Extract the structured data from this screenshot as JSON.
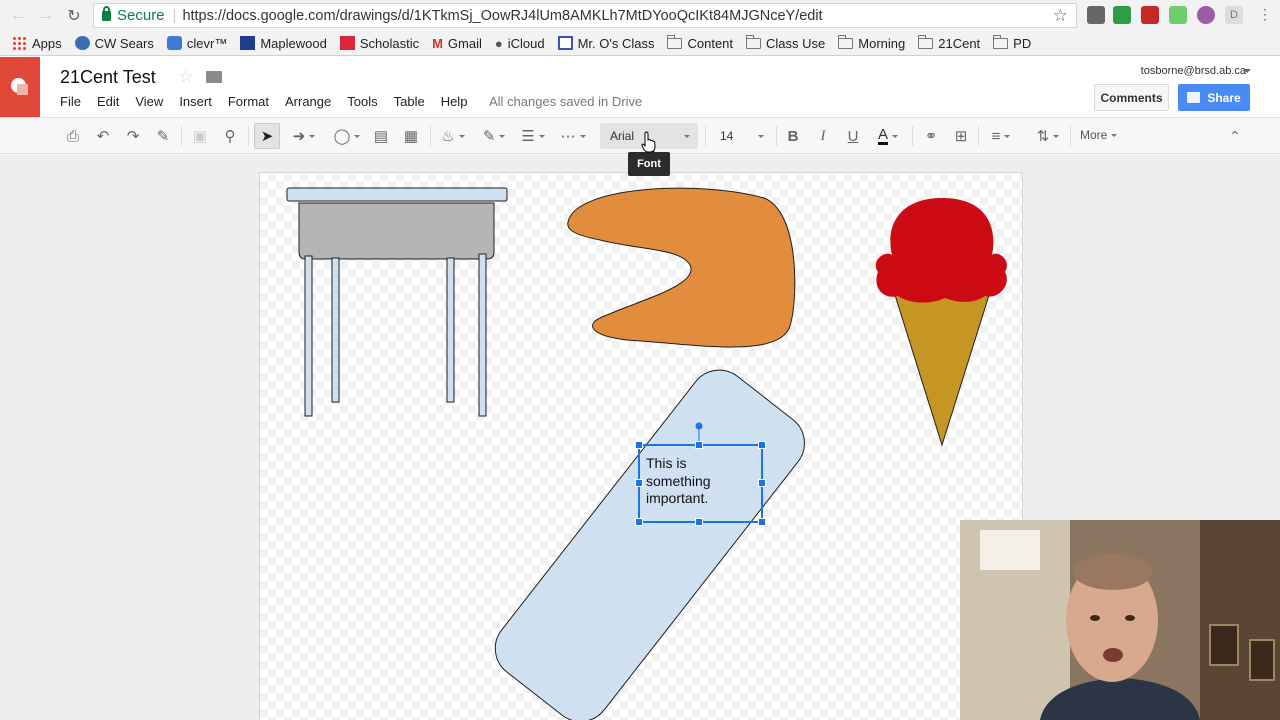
{
  "browser": {
    "secure_label": "Secure",
    "url": "https://docs.google.com/drawings/d/1KTkmSj_OowRJ4lUm8AMKLh7MtDYooQcIKt84MJGNceY/edit",
    "bookmarks": [
      {
        "label": "Apps",
        "icon": "apps-grid-icon"
      },
      {
        "label": "CW Sears",
        "icon": "cw-sears-icon"
      },
      {
        "label": "clevr™",
        "icon": "clever-icon"
      },
      {
        "label": "Maplewood",
        "icon": "maplewood-icon"
      },
      {
        "label": "Scholastic",
        "icon": "scholastic-icon"
      },
      {
        "label": "Gmail",
        "icon": "gmail-icon"
      },
      {
        "label": "iCloud",
        "icon": "apple-icon"
      },
      {
        "label": "Mr. O's Class",
        "icon": "calendar-icon"
      },
      {
        "label": "Content",
        "icon": "folder-icon"
      },
      {
        "label": "Class Use",
        "icon": "folder-icon"
      },
      {
        "label": "Morning",
        "icon": "folder-icon"
      },
      {
        "label": "21Cent",
        "icon": "folder-icon"
      },
      {
        "label": "PD",
        "icon": "folder-icon"
      }
    ]
  },
  "doc": {
    "title": "21Cent Test",
    "menus": [
      "File",
      "Edit",
      "View",
      "Insert",
      "Format",
      "Arrange",
      "Tools",
      "Table",
      "Help"
    ],
    "save_status": "All changes saved in Drive",
    "account": "tosborne@brsd.ab.ca",
    "comments_label": "Comments",
    "share_label": "Share"
  },
  "toolbar": {
    "font": "Arial",
    "font_size": "14",
    "more_label": "More",
    "tooltip": "Font",
    "bold_label": "B",
    "italic_label": "I",
    "underline_label": "U",
    "text_color_label": "A"
  },
  "canvas": {
    "textbox_line1": "This is",
    "textbox_line2": "something",
    "textbox_line3": "important."
  },
  "colors": {
    "brand_red": "#e0483a",
    "share_blue": "#4a8af4",
    "desk_top": "#cfe0f0",
    "desk_body": "#b5b5b5",
    "blob_orange": "#e28d3e",
    "icecream_red": "#cc0a14",
    "cone_gold": "#c69624",
    "rect_blue": "#cfe0f0",
    "selection_blue": "#1a73e8"
  }
}
